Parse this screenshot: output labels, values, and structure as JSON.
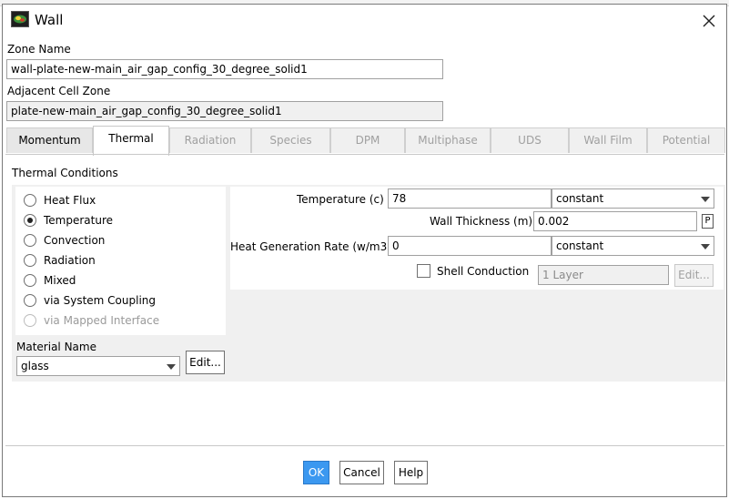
{
  "window": {
    "title": "Wall"
  },
  "zone": {
    "zone_name_label": "Zone Name",
    "zone_name_value": "wall-plate-new-main_air_gap_config_30_degree_solid1",
    "adjacent_label": "Adjacent Cell Zone",
    "adjacent_value": "plate-new-main_air_gap_config_30_degree_solid1"
  },
  "tabs": [
    {
      "label": "Momentum",
      "state": "enabled"
    },
    {
      "label": "Thermal",
      "state": "selected"
    },
    {
      "label": "Radiation",
      "state": "disabled"
    },
    {
      "label": "Species",
      "state": "disabled"
    },
    {
      "label": "DPM",
      "state": "disabled"
    },
    {
      "label": "Multiphase",
      "state": "disabled"
    },
    {
      "label": "UDS",
      "state": "disabled"
    },
    {
      "label": "Wall Film",
      "state": "disabled"
    },
    {
      "label": "Potential",
      "state": "disabled"
    }
  ],
  "thermal": {
    "conditions_label": "Thermal Conditions",
    "options": [
      {
        "label": "Heat Flux",
        "checked": false,
        "disabled": false
      },
      {
        "label": "Temperature",
        "checked": true,
        "disabled": false
      },
      {
        "label": "Convection",
        "checked": false,
        "disabled": false
      },
      {
        "label": "Radiation",
        "checked": false,
        "disabled": false
      },
      {
        "label": "Mixed",
        "checked": false,
        "disabled": false
      },
      {
        "label": "via System Coupling",
        "checked": false,
        "disabled": false
      },
      {
        "label": "via Mapped Interface",
        "checked": false,
        "disabled": true
      }
    ],
    "temperature_label": "Temperature (c)",
    "temperature_value": "78",
    "temperature_method": "constant",
    "wall_thickness_label": "Wall Thickness (m)",
    "wall_thickness_value": "0.002",
    "param_button": "P",
    "heat_gen_label": "Heat Generation Rate (w/m3)",
    "heat_gen_value": "0",
    "heat_gen_method": "constant",
    "shell_conduction_label": "Shell Conduction",
    "shell_conduction_checked": false,
    "layers_value": "1 Layer",
    "layers_edit": "Edit...",
    "material_label": "Material Name",
    "material_value": "glass",
    "material_edit": "Edit..."
  },
  "buttons": {
    "ok": "OK",
    "cancel": "Cancel",
    "help": "Help"
  },
  "colors": {
    "accent": "#3b98f0",
    "panel": "#f0f0f0"
  }
}
